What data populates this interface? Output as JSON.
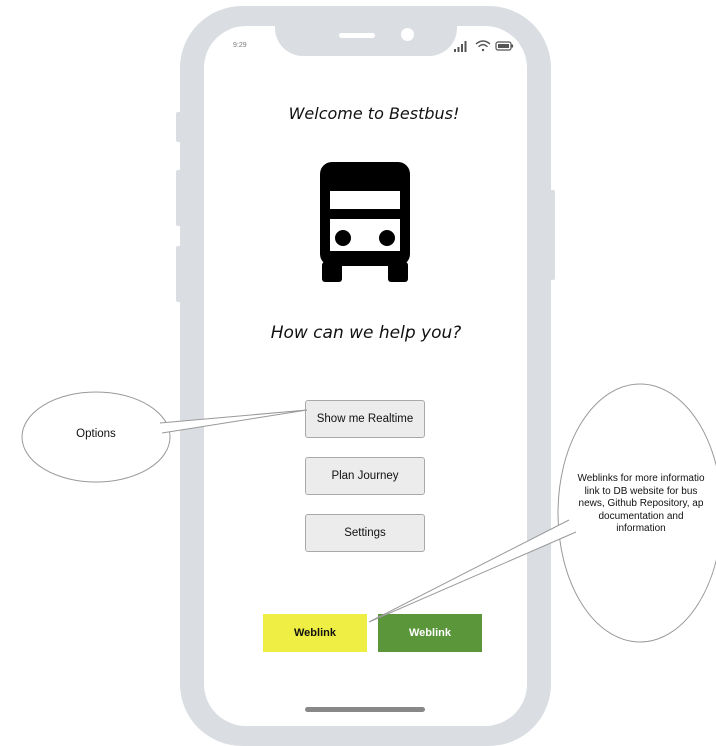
{
  "status_bar": {
    "time": "9:29"
  },
  "screen": {
    "title": "Welcome to Bestbus!",
    "subtitle": "How can we help you?",
    "icon": "bus-icon"
  },
  "menu": {
    "realtime_label": "Show me Realtime",
    "plan_label": "Plan Journey",
    "settings_label": "Settings"
  },
  "weblinks": {
    "left_label": "Weblink",
    "right_label": "Weblink",
    "left_color": "#eeee44",
    "right_color": "#5b963b"
  },
  "annotations": {
    "options": "Options",
    "weblinks_lines": [
      "Weblinks for more informatio",
      "link to DB website for bus",
      "news, Github Repository, ap",
      "documentation and",
      "information"
    ]
  }
}
